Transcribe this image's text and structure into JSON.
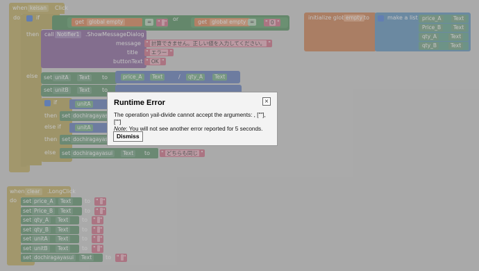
{
  "event1": {
    "when": "when",
    "component": "keisan",
    "event": "Click",
    "do": "do",
    "if": "if",
    "then": "then",
    "else": "else",
    "get": "get",
    "global_empty": "global empty",
    "eq": "=",
    "or": "or",
    "zero": "0",
    "empty_str": "",
    "call": "call",
    "notifier": "Notifier1",
    "method": ".ShowMessageDialog",
    "message_label": "message",
    "title_label": "title",
    "button_label": "buttonText",
    "message": "計算できません。正しい値を入力してください。",
    "title": "エラー",
    "button": "OK",
    "set": "set",
    "to": "to",
    "unitA": "unitA",
    "unitB": "unitB",
    "text": "Text",
    "divide": "/",
    "priceA": "price_A",
    "priceB": "Price_B",
    "qtyA": "qty_A",
    "qtyB": "qty_B",
    "else_if": "else if",
    "dochira": "dochiragayasui",
    "dochira_value": "どちらも同じ"
  },
  "global": {
    "initialize": "initialize global",
    "name": "empty",
    "to": "to",
    "make_list": "make a list",
    "items": [
      {
        "comp": "price_A",
        "prop": "Text"
      },
      {
        "comp": "Price_B",
        "prop": "Text"
      },
      {
        "comp": "qty_A",
        "prop": "Text"
      },
      {
        "comp": "qty_B",
        "prop": "Text"
      }
    ]
  },
  "event2": {
    "when": "when",
    "component": "clear",
    "event": ".LongClick",
    "do": "do",
    "set": "set",
    "to": "to",
    "rows": [
      {
        "comp": "price_A",
        "prop": "Text"
      },
      {
        "comp": "Price_B",
        "prop": "Text"
      },
      {
        "comp": "qty_A",
        "prop": "Text"
      },
      {
        "comp": "qty_B",
        "prop": "Text"
      },
      {
        "comp": "unitA",
        "prop": "Text"
      },
      {
        "comp": "unitB",
        "prop": "Text"
      },
      {
        "comp": "dochiragayasui",
        "prop": "Text"
      }
    ]
  },
  "dialog": {
    "title": "Runtime Error",
    "close": "×",
    "line1": "The operation yail-divide cannot accept the arguments: , [\"\"], [\"\"]",
    "note_label": "Note",
    "line2": ": You will not see another error reported for 5 seconds.",
    "dismiss": "Dismiss"
  }
}
